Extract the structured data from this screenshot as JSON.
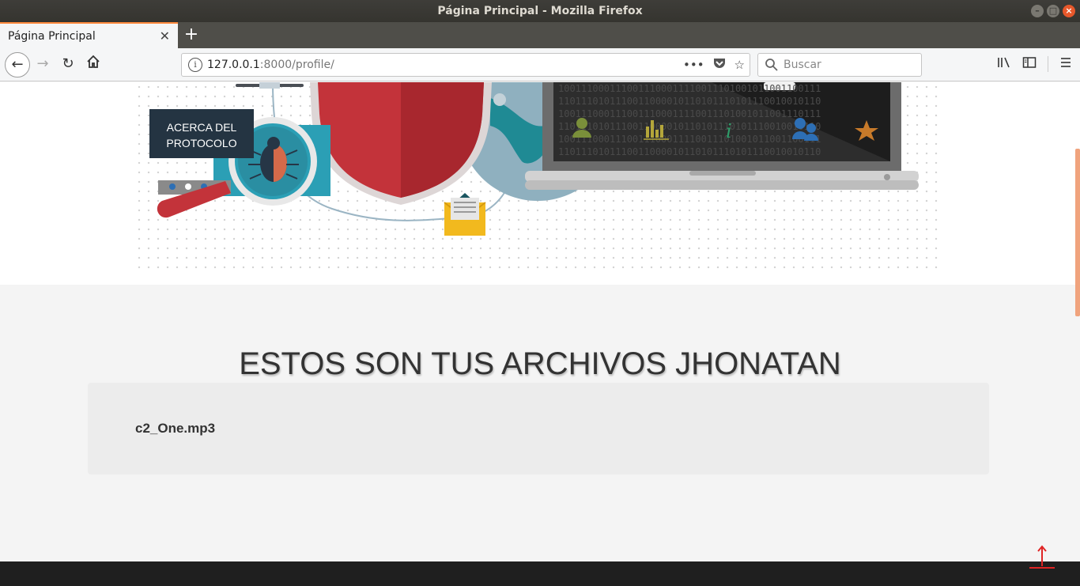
{
  "window": {
    "title": "Página Principal - Mozilla Firefox"
  },
  "tabs": [
    {
      "label": "Página Principal"
    }
  ],
  "navbar": {
    "url_host": "127.0.0.1",
    "url_rest": ":8000/profile/",
    "search_placeholder": "Buscar",
    "more_glyph": "•••"
  },
  "hero": {
    "about_button_line1": "ACERCA DEL",
    "about_button_line2": "PROTOCOLO"
  },
  "files": {
    "heading": "ESTOS SON TUS ARCHIVOS JHONATAN",
    "items": [
      {
        "name": "c2_One.mp3"
      }
    ]
  },
  "colors": {
    "accent_orange": "#ff8a3d",
    "button_dark": "#243442",
    "scroll_top_red": "#e02424"
  }
}
